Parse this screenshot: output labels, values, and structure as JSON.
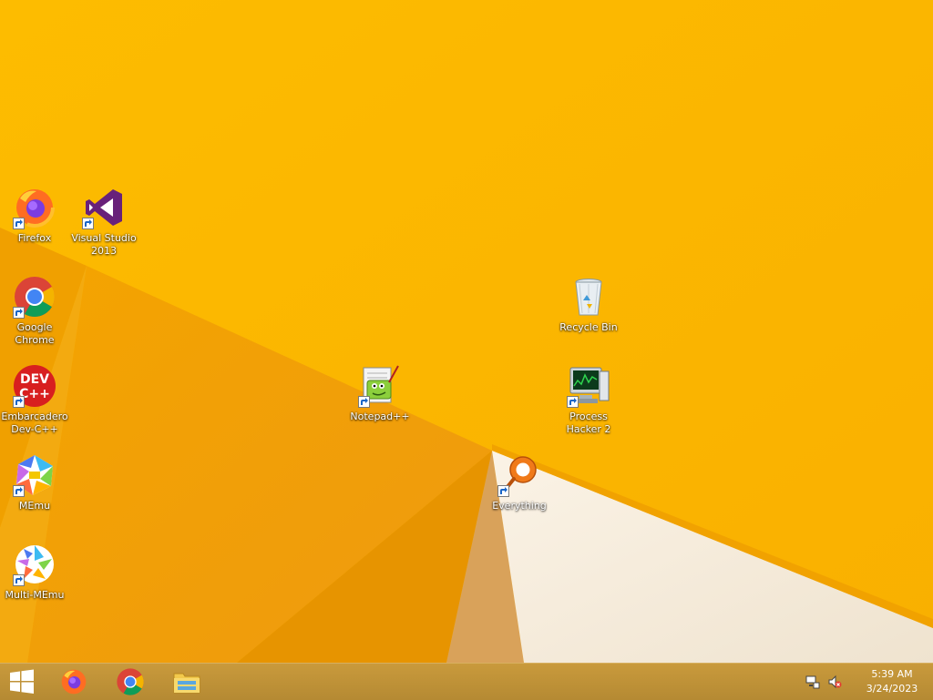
{
  "desktop": {
    "icons": [
      {
        "label": "Firefox"
      },
      {
        "label": "Visual Studio 2013"
      },
      {
        "label": "Google Chrome"
      },
      {
        "label": "Embarcadero Dev-C++"
      },
      {
        "label": "MEmu"
      },
      {
        "label": "Multi-MEmu"
      },
      {
        "label": "Notepad++"
      },
      {
        "label": "Recycle Bin"
      },
      {
        "label": "Process Hacker 2"
      },
      {
        "label": "Everything"
      }
    ],
    "devcpp_glyph_text": "DEV C++"
  },
  "taskbar": {
    "pinned": [
      "firefox-icon",
      "chrome-icon",
      "file-explorer-icon"
    ],
    "clock": {
      "time": "5:39 AM",
      "date": "3/24/2023"
    }
  },
  "colors": {
    "wallpaper_main": "#f7b500",
    "wallpaper_shadow": "#e89a00",
    "wallpaper_light": "#f6ead8",
    "taskbar": "#c19238"
  }
}
